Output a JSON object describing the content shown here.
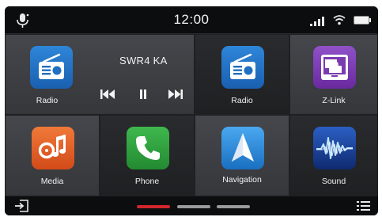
{
  "status": {
    "time": "12:00",
    "icons": [
      "microphone-icon",
      "cellular-signal-icon",
      "wifi-icon",
      "battery-icon"
    ]
  },
  "now_playing": {
    "station": "SWR4 KA",
    "controls": [
      "skip-previous-icon",
      "pause-icon",
      "skip-next-icon"
    ]
  },
  "apps": [
    {
      "label": "Radio",
      "icon": "radio-icon"
    },
    {
      "label": "Radio",
      "icon": "radio-icon"
    },
    {
      "label": "Z-Link",
      "icon": "z-link-icon"
    },
    {
      "label": "Media",
      "icon": "media-icon"
    },
    {
      "label": "Phone",
      "icon": "phone-icon"
    },
    {
      "label": "Navigation",
      "icon": "navigation-icon"
    },
    {
      "label": "Sound",
      "icon": "sound-icon"
    }
  ],
  "pager": {
    "pages": 3,
    "active": 0
  },
  "dock": {
    "left": "exit-icon",
    "right": "menu-icon"
  },
  "colors": {
    "background": "#2b2c2f",
    "bars": "#0c0d0f",
    "pager_active": "#d0262c",
    "pager_inactive": "#9a9a9a",
    "radio": "#1f6fc2",
    "z_link": "#7b3bb0",
    "media": "#e25a24",
    "phone": "#2e9e3d",
    "navigation": "#1e84d6",
    "sound": "#1a3a8c"
  }
}
